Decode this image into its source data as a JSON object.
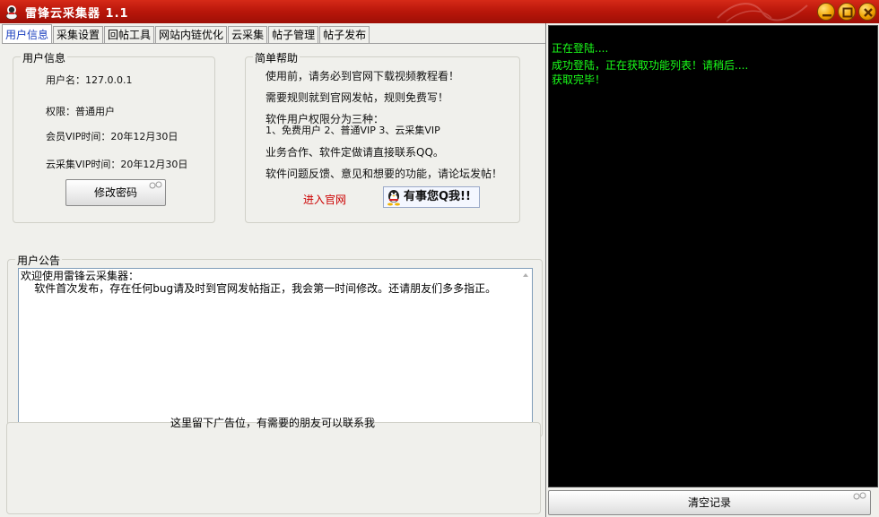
{
  "window": {
    "title": "雷锋云采集器 1.1"
  },
  "tabs": [
    {
      "label": "用户信息"
    },
    {
      "label": "采集设置"
    },
    {
      "label": "回帖工具"
    },
    {
      "label": "网站内链优化"
    },
    {
      "label": "云采集"
    },
    {
      "label": "帖子管理"
    },
    {
      "label": "帖子发布"
    }
  ],
  "user_info": {
    "group_title": "用户信息",
    "username": "用户名：127.0.0.1",
    "permission": "权限：普通用户",
    "vip_time": "会员VIP时间：20年12月30日",
    "cloud_vip_time": "云采集VIP时间：20年12月30日",
    "change_password_label": "修改密码"
  },
  "help": {
    "group_title": "简单帮助",
    "line1": "使用前，请务必到官网下载视频教程看！",
    "line2": "需要规则就到官网发帖，规则免费写！",
    "line3": "软件用户权限分为三种：",
    "line4": "1、免费用户   2、普通VIP   3、云采集VIP",
    "line5": "业务合作、软件定做请直接联系QQ。",
    "line6": "软件问题反馈、意见和想要的功能，请论坛发帖！",
    "official_site_link": "进入官网",
    "qq_badge": "有事您Q我!!"
  },
  "announcement": {
    "group_title": "用户公告",
    "text": "欢迎使用雷锋云采集器：\n    软件首次发布，存在任何bug请及时到官网发帖指正，我会第一时间修改。还请朋友们多多指正。"
  },
  "ad": {
    "text": "这里留下广告位，有需要的朋友可以联系我"
  },
  "log": {
    "lines": [
      "正在登陆....",
      "成功登陆，正在获取功能列表！请稍后....",
      "获取完毕！"
    ],
    "clear_label": "清空记录"
  },
  "colors": {
    "titlebar": "#b8160a",
    "log_bg": "#000000",
    "log_text": "#1aff1a",
    "active_tab_text": "#1a3fbf",
    "link_red": "#cc0000"
  }
}
